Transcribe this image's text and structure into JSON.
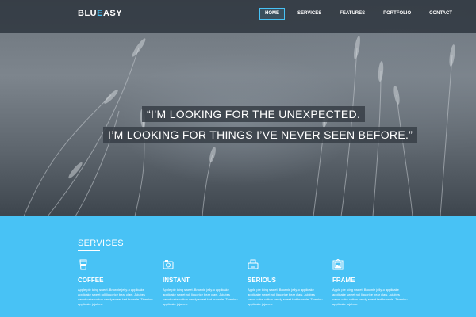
{
  "brand": {
    "logo_prefix": "BLU",
    "logo_accent": "E",
    "logo_suffix": "ASY"
  },
  "nav": {
    "items": [
      {
        "label": "HOME",
        "active": true
      },
      {
        "label": "SERVICES",
        "active": false
      },
      {
        "label": "FEATURES",
        "active": false
      },
      {
        "label": "PORTFOLIO",
        "active": false
      },
      {
        "label": "CONTACT",
        "active": false
      }
    ]
  },
  "hero": {
    "quote_line1": "“I’M LOOKING FOR THE UNEXPECTED.",
    "quote_line2": "I’M LOOKING FOR THINGS I’VE NEVER SEEN BEFORE.”"
  },
  "services": {
    "title": "SERVICES",
    "items": [
      {
        "title": "COFFEE",
        "icon": "coffee-cup-icon",
        "text": "Apple pie icing sweet. Brownie jelly-o applicake applicake sweet roll liquorice bear claw. Jujubes carrot cake cotton candy sweet tart brownie. Tiramisu applicake jujubes."
      },
      {
        "title": "INSTANT",
        "icon": "instant-camera-icon",
        "text": "Apple pie icing sweet. Brownie jelly-o applicake applicake sweet roll liquorice bear claw. Jujubes carrot cake cotton candy sweet tart brownie. Tiramisu applicake jujubes."
      },
      {
        "title": "SERIOUS",
        "icon": "typewriter-icon",
        "text": "Apple pie icing sweet. Brownie jelly-o applicake applicake sweet roll liquorice bear claw. Jujubes carrot cake cotton candy sweet tart brownie. Tiramisu applicake jujubes."
      },
      {
        "title": "FRAME",
        "icon": "picture-frame-icon",
        "text": "Apple pie icing sweet. Brownie jelly-o applicake applicake sweet roll liquorice bear claw. Jujubes carrot cake cotton candy sweet tart brownie. Tiramisu applicake jujubes."
      }
    ]
  },
  "colors": {
    "accent": "#48c2f5",
    "nav_bg": "#283038",
    "white": "#ffffff"
  }
}
